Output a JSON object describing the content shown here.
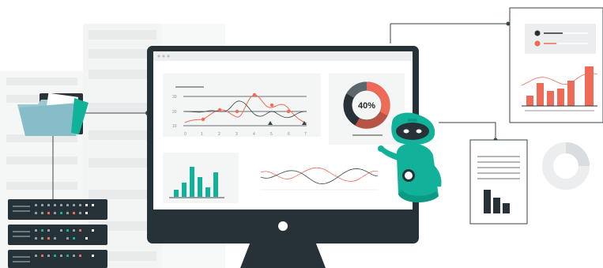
{
  "colors": {
    "accent_red": "#ef6b57",
    "dark": "#263238",
    "teal": "#12b29a",
    "paper": "#ffffff",
    "panel": "#f4f5f5",
    "light_gray": "#ebedee"
  },
  "dashboard": {
    "line_chart": {
      "y_ticks": [
        "30",
        "20",
        "10"
      ],
      "x_ticks": [
        "0",
        "1",
        "2",
        "3",
        "4",
        "5",
        "6",
        "7"
      ]
    },
    "donut": {
      "percent_label": "40%"
    }
  },
  "icons": [
    "folder-icon",
    "server-rack-icon",
    "robot-icon",
    "document-icon",
    "donut-chart-icon"
  ]
}
